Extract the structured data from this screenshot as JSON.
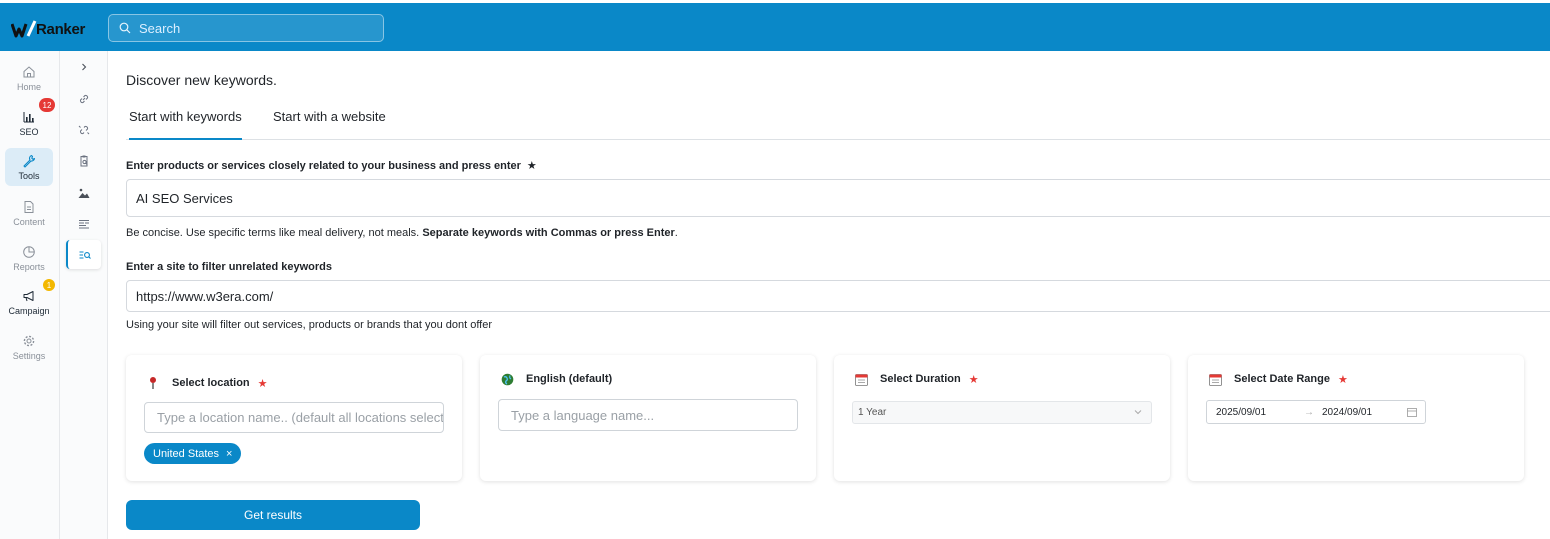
{
  "app": {
    "logo_text": "Ranker"
  },
  "search": {
    "placeholder": "Search"
  },
  "rail": {
    "items": [
      {
        "label": "Home",
        "icon": "home-icon"
      },
      {
        "label": "SEO",
        "icon": "bar-chart-icon",
        "badge": "12"
      },
      {
        "label": "Tools",
        "icon": "wrench-icon",
        "active": true
      },
      {
        "label": "Content",
        "icon": "document-icon"
      },
      {
        "label": "Reports",
        "icon": "pie-chart-icon"
      },
      {
        "label": "Campaign",
        "icon": "megaphone-icon",
        "badge": "1"
      },
      {
        "label": "Settings",
        "icon": "gear-icon"
      }
    ]
  },
  "subrail": {
    "icons": [
      "chevron-right-icon",
      "link-icon",
      "broken-link-icon",
      "clipboard-search-icon",
      "image-icon",
      "list-icon",
      "keyword-search-icon"
    ]
  },
  "main": {
    "heading": "Discover new keywords.",
    "tabs": [
      {
        "label": "Start with keywords",
        "active": true
      },
      {
        "label": "Start with a website",
        "active": false
      }
    ],
    "keywords_label": "Enter products or services closely related to your business and press enter",
    "required_mark": "★",
    "keywords_value": "AI SEO Services",
    "keywords_help_prefix": "Be concise. Use specific terms like meal delivery, not meals.",
    "keywords_help_bold": "Separate keywords with Commas or press Enter",
    "keywords_help_suffix": ".",
    "site_label": "Enter a site to filter unrelated keywords",
    "site_value": "https://www.w3era.com/",
    "site_help": "Using your site will filter out services, products or brands that you dont offer"
  },
  "cards": {
    "location": {
      "title": "Select location",
      "required": "★",
      "placeholder": "Type a location name.. (default all locations selected)",
      "chip": "United States",
      "chip_remove": "×"
    },
    "language": {
      "title": "English (default)",
      "placeholder": "Type a language name..."
    },
    "duration": {
      "title": "Select Duration",
      "required": "★",
      "value": "1 Year"
    },
    "date_range": {
      "title": "Select Date Range",
      "required": "★",
      "start": "2025/09/01",
      "arrow": "→",
      "end": "2024/09/01"
    }
  },
  "button": {
    "label": "Get results"
  },
  "colors": {
    "accent": "#0a88c8",
    "required": "#e53935",
    "badge_red": "#e53935",
    "badge_yellow": "#f3b800"
  }
}
